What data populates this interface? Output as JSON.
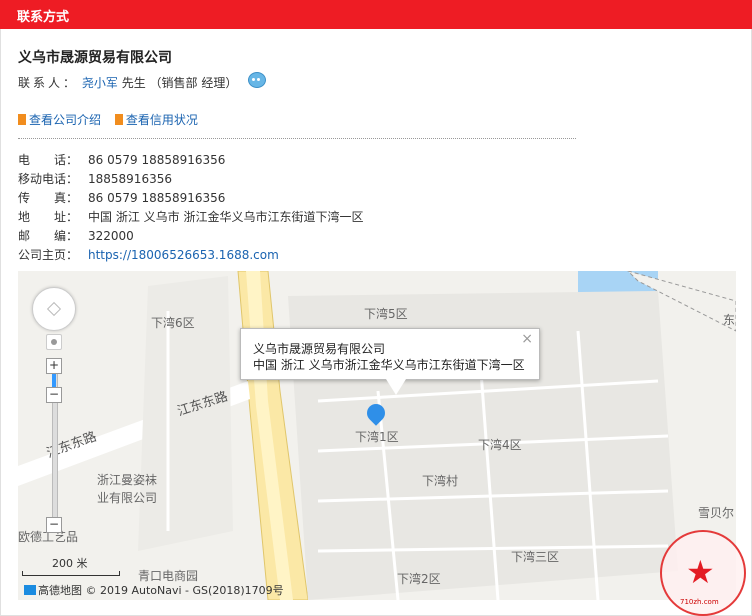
{
  "header": {
    "title": "联系方式"
  },
  "company": {
    "name": "义乌市晟源贸易有限公司"
  },
  "contact": {
    "label": "联系人：",
    "name": "尧小军",
    "detail": "先生 （销售部 经理）"
  },
  "links": [
    {
      "label": "查看公司介绍"
    },
    {
      "label": "查看信用状况"
    }
  ],
  "info": [
    {
      "label": "电　　话：",
      "value": "86 0579 18858916356"
    },
    {
      "label": "移动电话：",
      "value": "18858916356"
    },
    {
      "label": "传　　真：",
      "value": "86 0579 18858916356"
    },
    {
      "label": "地　　址：",
      "value": "中国 浙江 义乌市 浙江金华义乌市江东街道下湾一区"
    },
    {
      "label": "邮　　编：",
      "value": "322000"
    },
    {
      "label": "公司主页：",
      "value": "https://18006526653.1688.com"
    }
  ],
  "map": {
    "popup_line1": "义乌市晟源贸易有限公司",
    "popup_line2": "中国 浙江 义乌市浙江金华义乌市江东街道下湾一区",
    "labels": [
      "下湾6区",
      "下湾5区",
      "下湾1区",
      "下湾4区",
      "下湾村",
      "下湾三区",
      "下湾2区",
      "江东东路",
      "江东东路",
      "浙江曼姿袜",
      "业有限公司",
      "欧德工艺品",
      "青口电商园",
      "雪贝尔",
      "东"
    ],
    "scale": "200 米",
    "copyright": "高德地图 © 2019 AutoNavi - GS(2018)1709号",
    "close": "×",
    "zoom_in": "+",
    "zoom_out": "−"
  },
  "stamp": {
    "text": "710zh.com"
  },
  "colors": {
    "header": "#ee1c24",
    "link": "#1a63b0",
    "pin": "#2f8fe8"
  }
}
